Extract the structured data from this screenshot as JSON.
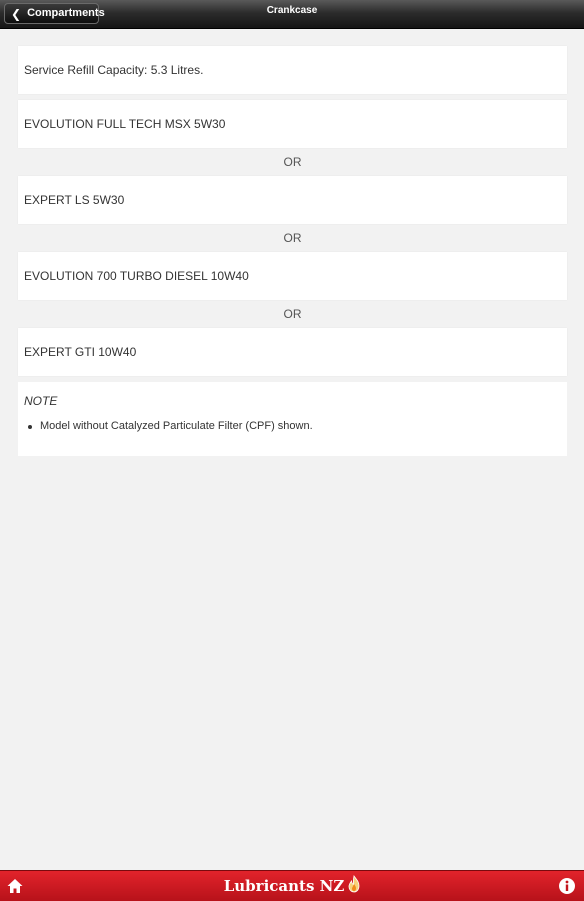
{
  "topbar": {
    "back_label": "Compartments",
    "title": "Crankcase"
  },
  "capacity_text": "Service Refill Capacity: 5.3 Litres.",
  "products": [
    "EVOLUTION FULL TECH MSX 5W30",
    "EXPERT LS 5W30",
    "EVOLUTION 700 TURBO DIESEL 10W40",
    "EXPERT GTI 10W40"
  ],
  "separator_label": "OR",
  "note": {
    "title": "NOTE",
    "items": [
      "Model without Catalyzed Particulate Filter (CPF) shown."
    ]
  },
  "bottombar": {
    "brand_text": "Lubricants NZ",
    "home_icon": "home-icon",
    "info_icon": "info-icon",
    "accent_color": "#d81e26"
  }
}
